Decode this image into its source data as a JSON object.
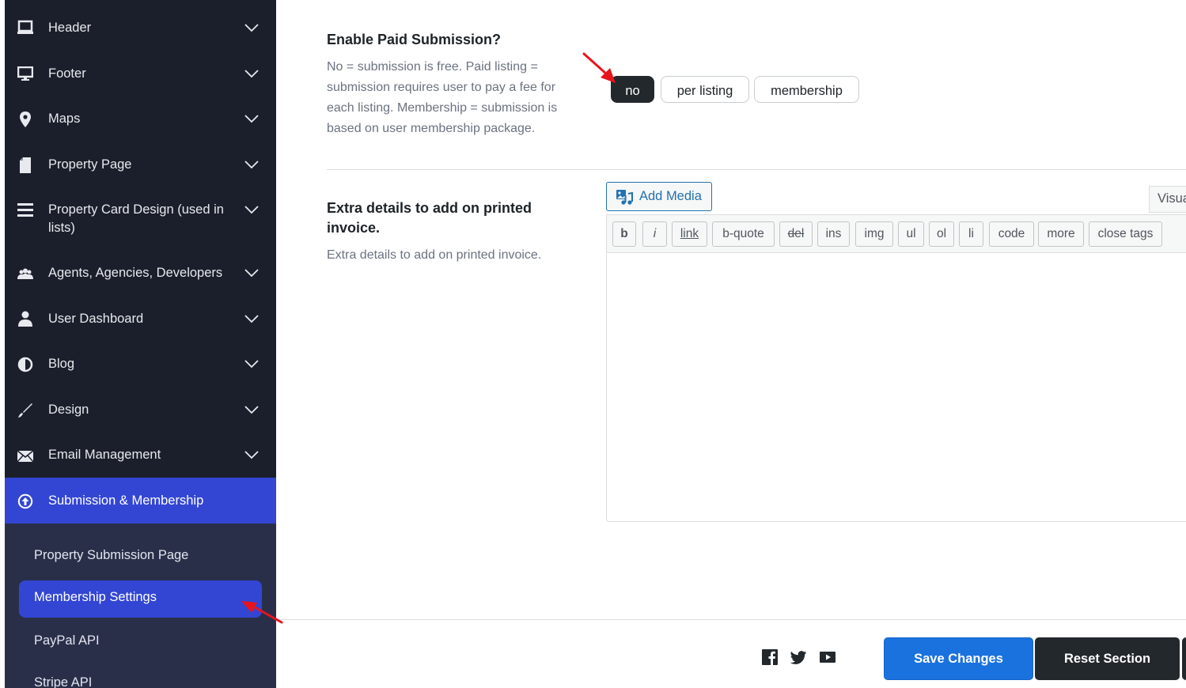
{
  "sidebar": {
    "items": [
      {
        "label": "Header",
        "icon": "laptop-icon"
      },
      {
        "label": "Footer",
        "icon": "desktop-icon"
      },
      {
        "label": "Maps",
        "icon": "map-pin-icon"
      },
      {
        "label": "Property Page",
        "icon": "document-icon"
      },
      {
        "label": "Property Card Design (used in lists)",
        "icon": "list-icon"
      },
      {
        "label": "Agents, Agencies, Developers",
        "icon": "group-icon"
      },
      {
        "label": "User Dashboard",
        "icon": "user-icon"
      },
      {
        "label": "Blog",
        "icon": "half-circle-icon"
      },
      {
        "label": "Design",
        "icon": "brush-icon"
      },
      {
        "label": "Email Management",
        "icon": "envelope-icon"
      },
      {
        "label": "Submission & Membership",
        "icon": "upload-circle-icon"
      }
    ],
    "submenu": [
      {
        "label": "Property Submission Page"
      },
      {
        "label": "Membership Settings"
      },
      {
        "label": "PayPal API"
      },
      {
        "label": "Stripe API"
      }
    ]
  },
  "paid_submission": {
    "title": "Enable Paid Submission?",
    "description": "No = submission is free. Paid listing = submission requires user to pay a fee for each listing. Membership = submission is based on user membership package.",
    "options": [
      "no",
      "per listing",
      "membership"
    ],
    "selected": "no"
  },
  "invoice": {
    "title": "Extra details to add on printed invoice.",
    "description": "Extra details to add on printed invoice.",
    "add_media_label": "Add Media",
    "visual_tab_label": "Visual",
    "editor_value": "",
    "quicktags": [
      "b",
      "i",
      "link",
      "b-quote",
      "del",
      "ins",
      "img",
      "ul",
      "ol",
      "li",
      "code",
      "more",
      "close tags"
    ]
  },
  "footer": {
    "social_icons": [
      "facebook-icon",
      "twitter-icon",
      "youtube-icon"
    ],
    "save_label": "Save Changes",
    "reset_label": "Reset Section"
  },
  "colors": {
    "sidebar_bg": "#1b1f2b",
    "submenu_bg": "#2a2f49",
    "accent": "#3346d3",
    "save_button": "#1a72de",
    "dark_button": "#23282d",
    "annotation_arrow": "#e8141c"
  }
}
